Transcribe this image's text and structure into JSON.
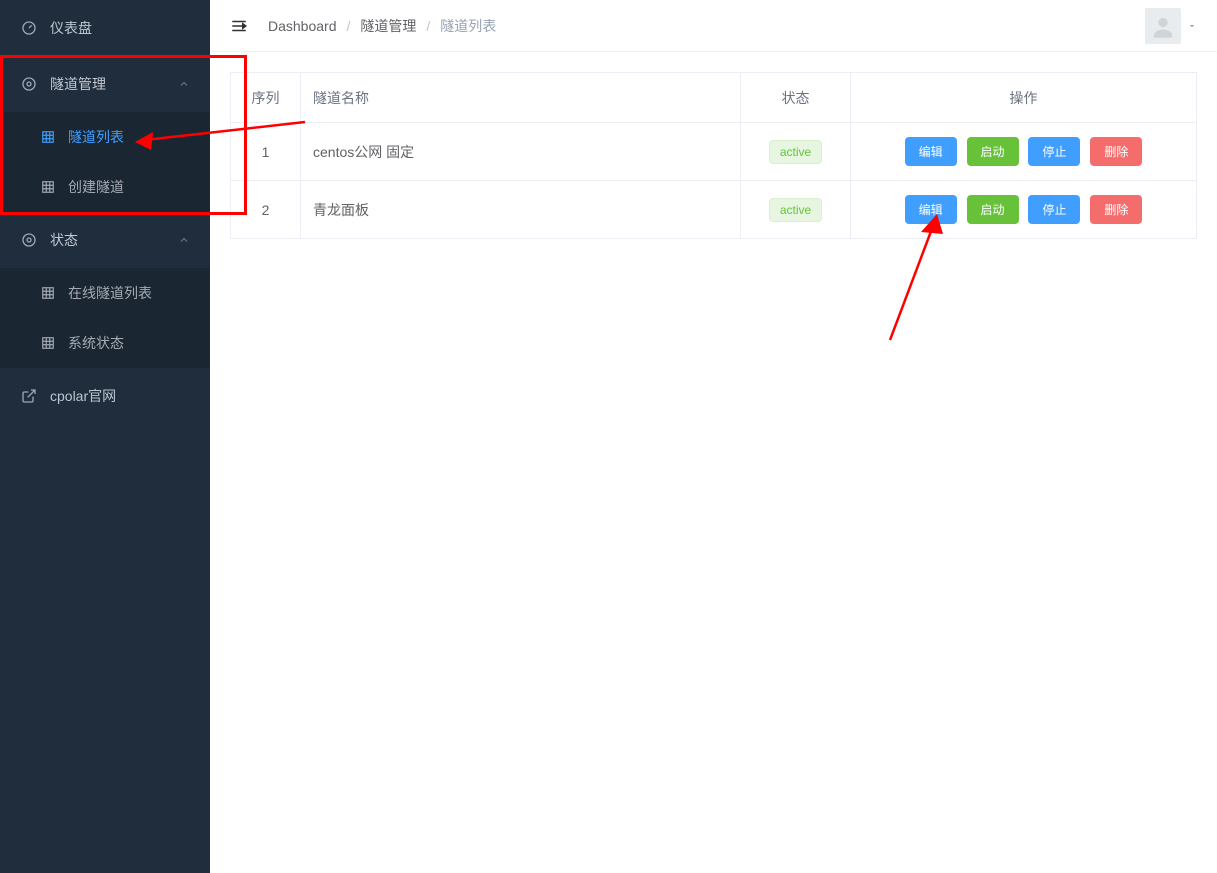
{
  "sidebar": {
    "dashboard_label": "仪表盘",
    "tunnel_section_label": "隧道管理",
    "tunnel_list_label": "隧道列表",
    "tunnel_create_label": "创建隧道",
    "status_section_label": "状态",
    "online_tunnel_label": "在线隧道列表",
    "system_status_label": "系统状态",
    "cpolar_label": "cpolar官网"
  },
  "breadcrumb": {
    "root": "Dashboard",
    "section": "隧道管理",
    "current": "隧道列表"
  },
  "table": {
    "headers": {
      "seq": "序列",
      "name": "隧道名称",
      "status": "状态",
      "actions": "操作"
    },
    "rows": [
      {
        "seq": "1",
        "name": "centos公网 固定",
        "status": "active"
      },
      {
        "seq": "2",
        "name": "青龙面板",
        "status": "active"
      }
    ],
    "action_labels": {
      "edit": "编辑",
      "start": "启动",
      "stop": "停止",
      "delete": "删除"
    }
  },
  "colors": {
    "sidebar_bg": "#1f2d3d",
    "active_link": "#409eff",
    "badge_bg": "#e7f6e1",
    "badge_text": "#67c23a",
    "btn_blue": "#409eff",
    "btn_green": "#67c23a",
    "btn_red": "#f56c6c",
    "annotation_red": "#ff0000"
  }
}
